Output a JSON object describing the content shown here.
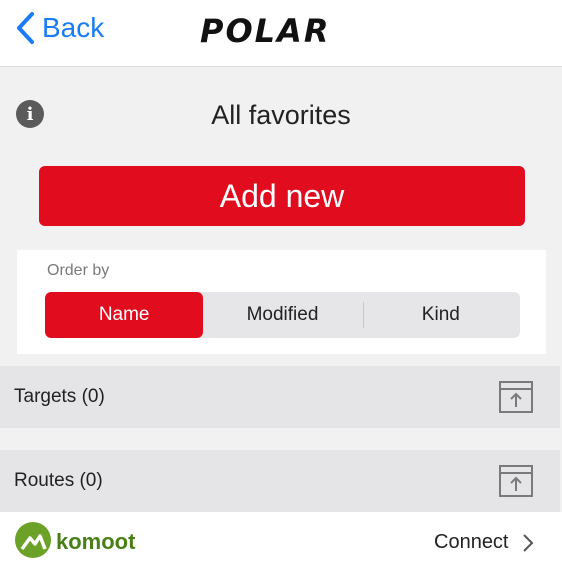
{
  "nav": {
    "back_label": "Back",
    "logo_text": "POLAR"
  },
  "header": {
    "title": "All favorites"
  },
  "actions": {
    "add_new_label": "Add new"
  },
  "order_by": {
    "label": "Order by",
    "options": [
      "Name",
      "Modified",
      "Kind"
    ],
    "selected": "Name"
  },
  "lists": [
    {
      "label": "Targets (0)",
      "icon": "add-to-watch-icon"
    },
    {
      "label": "Routes (0)",
      "icon": "add-to-watch-icon"
    }
  ],
  "komoot": {
    "brand": "komoot",
    "connect_label": "Connect"
  },
  "colors": {
    "accent": "#e10d1f",
    "link": "#1a7cf5",
    "komoot_green": "#6aa126"
  }
}
